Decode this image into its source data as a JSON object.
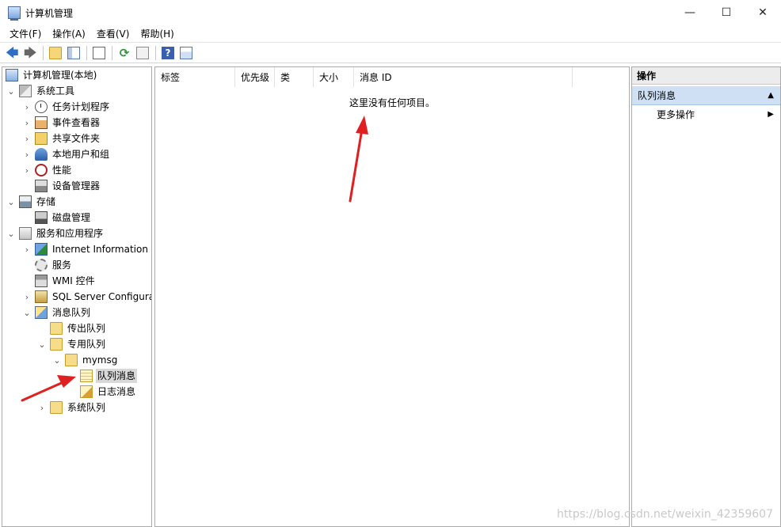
{
  "window": {
    "title": "计算机管理",
    "minimize": "—",
    "maximize": "☐",
    "close": "✕"
  },
  "menu": [
    "文件(F)",
    "操作(A)",
    "查看(V)",
    "帮助(H)"
  ],
  "toolbar": {
    "back": "🡄",
    "forward": "🡆",
    "refresh": "⟳",
    "help": "?"
  },
  "tree": {
    "items": [
      {
        "label": "计算机管理(本地)",
        "expander": "",
        "icon": "computer-icon"
      },
      {
        "label": "系统工具",
        "expander": "⌄",
        "icon": "tools-icon"
      },
      {
        "label": "任务计划程序",
        "expander": "›",
        "icon": "clock-icon"
      },
      {
        "label": "事件查看器",
        "expander": "›",
        "icon": "event-viewer-icon"
      },
      {
        "label": "共享文件夹",
        "expander": "›",
        "icon": "shared-folder-icon"
      },
      {
        "label": "本地用户和组",
        "expander": "›",
        "icon": "users-icon"
      },
      {
        "label": "性能",
        "expander": "›",
        "icon": "performance-icon"
      },
      {
        "label": "设备管理器",
        "expander": "",
        "icon": "device-manager-icon"
      },
      {
        "label": "存储",
        "expander": "⌄",
        "icon": "storage-icon"
      },
      {
        "label": "磁盘管理",
        "expander": "",
        "icon": "disk-icon"
      },
      {
        "label": "服务和应用程序",
        "expander": "⌄",
        "icon": "services-apps-icon"
      },
      {
        "label": "Internet Information S",
        "expander": "›",
        "icon": "iis-icon"
      },
      {
        "label": "服务",
        "expander": "",
        "icon": "gear-icon"
      },
      {
        "label": "WMI 控件",
        "expander": "",
        "icon": "wmi-icon"
      },
      {
        "label": "SQL Server Configura",
        "expander": "›",
        "icon": "sql-icon"
      },
      {
        "label": "消息队列",
        "expander": "⌄",
        "icon": "message-queue-icon"
      },
      {
        "label": "传出队列",
        "expander": "",
        "icon": "folder-icon"
      },
      {
        "label": "专用队列",
        "expander": "⌄",
        "icon": "folder-icon"
      },
      {
        "label": "mymsg",
        "expander": "⌄",
        "icon": "folder-icon"
      },
      {
        "label": "队列消息",
        "expander": "",
        "icon": "queue-messages-icon"
      },
      {
        "label": "日志消息",
        "expander": "",
        "icon": "journal-messages-icon"
      },
      {
        "label": "系统队列",
        "expander": "›",
        "icon": "folder-icon"
      }
    ]
  },
  "list": {
    "columns": [
      "标签",
      "优先级",
      "类",
      "大小",
      "消息 ID"
    ],
    "empty_text": "这里没有任何项目。"
  },
  "actions": {
    "title": "操作",
    "section": "队列消息",
    "section_arrow": "▲",
    "more": "更多操作",
    "more_arrow": "▶"
  },
  "watermark": "https://blog.csdn.net/weixin_42359607",
  "colors": {
    "annotation_arrow": "#e02020",
    "selection": "#d9d9d9",
    "action_section_bg": "#cfe0f4"
  }
}
